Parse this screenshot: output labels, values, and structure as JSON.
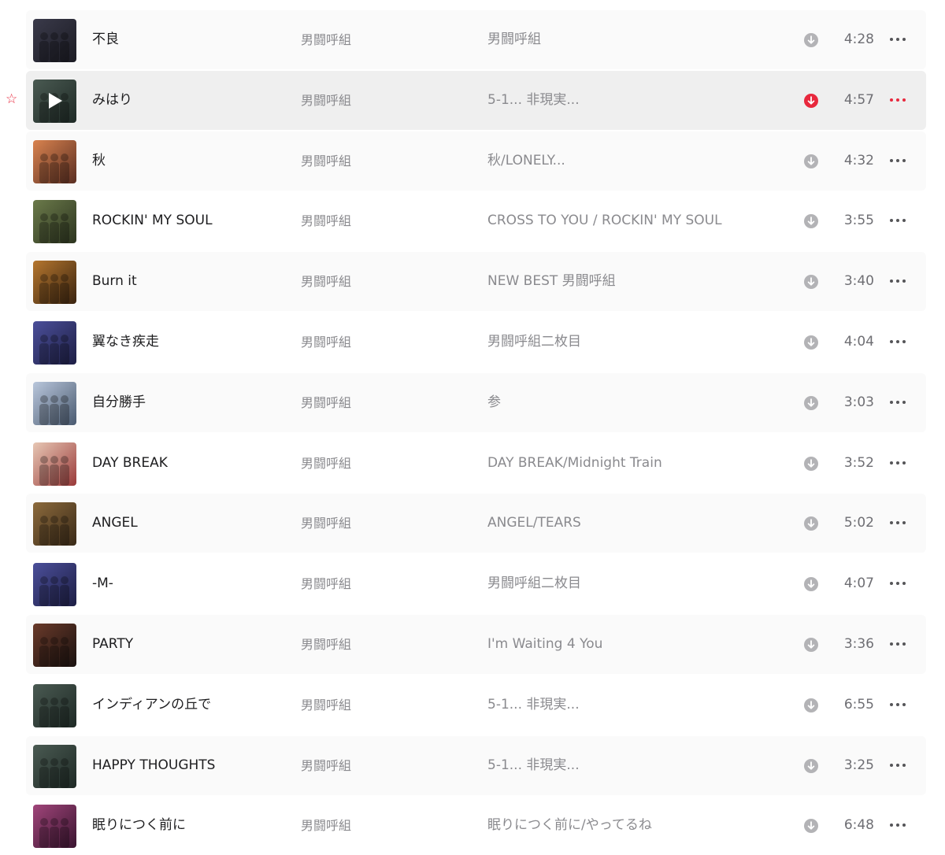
{
  "colors": {
    "accent": "#e8283d",
    "download_icon": "#b3b3b6",
    "row_bg": "#fafafa",
    "row_alt_bg": "#ffffff",
    "row_selected_bg": "#efefef",
    "text_primary": "#1d1d1f",
    "text_secondary": "#8a8a8e"
  },
  "icons": {
    "favorite": "star-icon",
    "play": "play-icon",
    "download": "download-icon",
    "more": "more-icon"
  },
  "tracks": [
    {
      "title": "不良",
      "artist": "男闘呼組",
      "album": "男闘呼組",
      "duration": "4:28",
      "art": [
        "#3a3a4a",
        "#1c1c24"
      ]
    },
    {
      "title": "みはり",
      "artist": "男闘呼組",
      "album": "5-1... 非現実...",
      "duration": "4:57",
      "art": [
        "#4a5a52",
        "#1f2a26"
      ],
      "selected": true,
      "favorite": "☆"
    },
    {
      "title": "秋",
      "artist": "男闘呼組",
      "album": "秋/LONELY...",
      "duration": "4:32",
      "art": [
        "#d9834f",
        "#5a2e22"
      ]
    },
    {
      "title": "ROCKIN' MY SOUL",
      "artist": "男闘呼組",
      "album": "CROSS TO YOU / ROCKIN' MY SOUL",
      "duration": "3:55",
      "art": [
        "#6b7a4a",
        "#2d3520"
      ]
    },
    {
      "title": "Burn it",
      "artist": "男闘呼組",
      "album": "NEW BEST 男闘呼組",
      "duration": "3:40",
      "art": [
        "#b5762e",
        "#3a2410"
      ]
    },
    {
      "title": "翼なき疾走",
      "artist": "男闘呼組",
      "album": "男闘呼組二枚目",
      "duration": "4:04",
      "art": [
        "#4b4f9a",
        "#1e1f45"
      ]
    },
    {
      "title": "自分勝手",
      "artist": "男闘呼組",
      "album": "参",
      "duration": "3:03",
      "art": [
        "#b9c7dc",
        "#4a5a70"
      ]
    },
    {
      "title": "DAY BREAK",
      "artist": "男闘呼組",
      "album": "DAY BREAK/Midnight Train",
      "duration": "3:52",
      "art": [
        "#e7c7b4",
        "#9a3a3a"
      ]
    },
    {
      "title": "ANGEL",
      "artist": "男闘呼組",
      "album": "ANGEL/TEARS",
      "duration": "5:02",
      "art": [
        "#8c6a3c",
        "#3a2a18"
      ]
    },
    {
      "title": "-M-",
      "artist": "男闘呼組",
      "album": "男闘呼組二枚目",
      "duration": "4:07",
      "art": [
        "#4b4f9a",
        "#1e1f45"
      ]
    },
    {
      "title": "PARTY",
      "artist": "男闘呼組",
      "album": "I'm Waiting 4 You",
      "duration": "3:36",
      "art": [
        "#6a3a2a",
        "#1a1210"
      ]
    },
    {
      "title": "インディアンの丘で",
      "artist": "男闘呼組",
      "album": "5-1... 非現実...",
      "duration": "6:55",
      "art": [
        "#4a5a52",
        "#1f2a26"
      ]
    },
    {
      "title": "HAPPY THOUGHTS",
      "artist": "男闘呼組",
      "album": "5-1... 非現実...",
      "duration": "3:25",
      "art": [
        "#4a5a52",
        "#1f2a26"
      ]
    },
    {
      "title": "眠りにつく前に",
      "artist": "男闘呼組",
      "album": "眠りにつく前に/やってるね",
      "duration": "6:48",
      "art": [
        "#a0457a",
        "#3a1530"
      ]
    }
  ]
}
